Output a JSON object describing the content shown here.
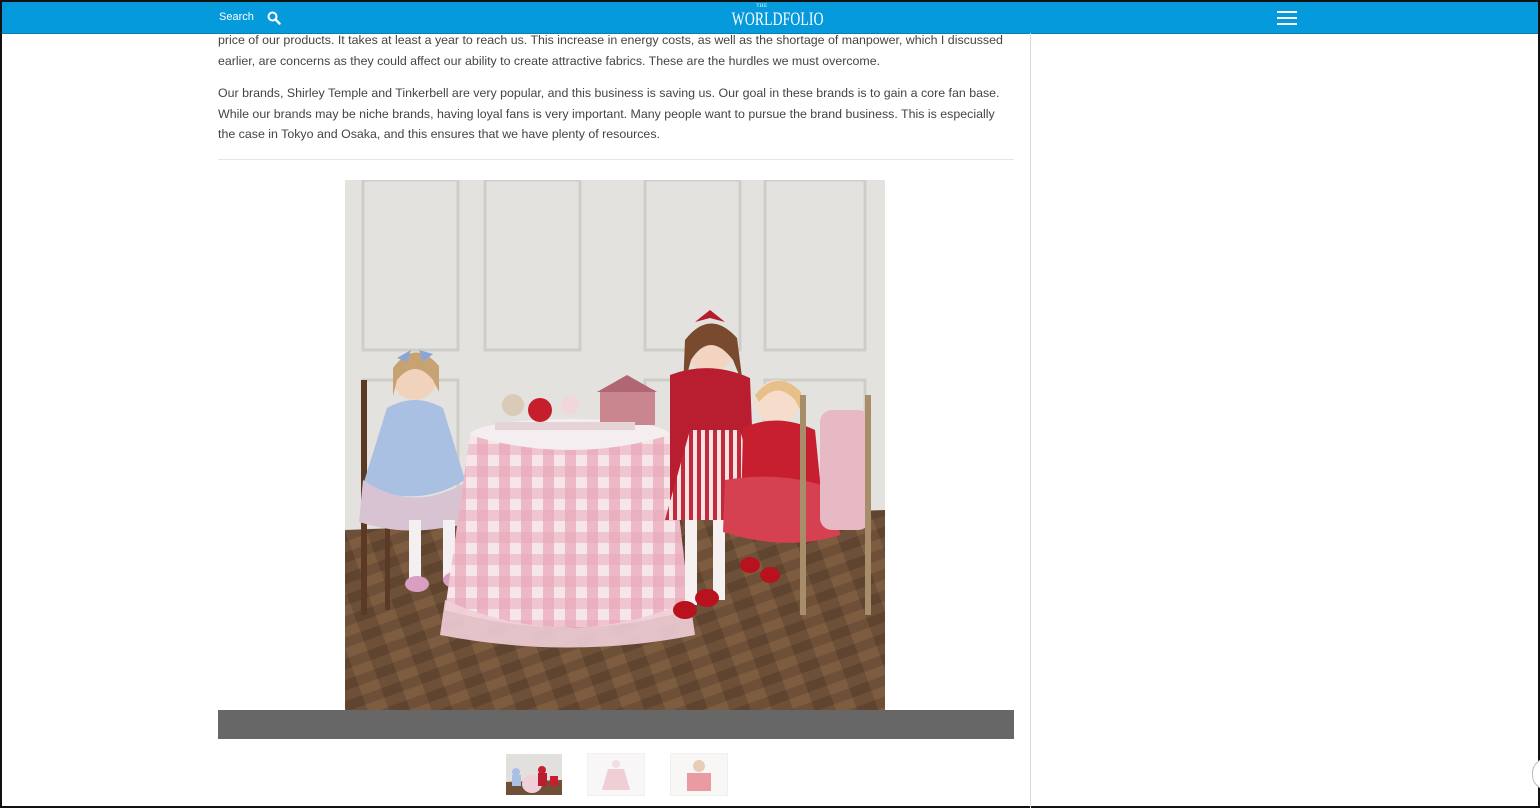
{
  "header": {
    "search_label": "Search",
    "logo_the": "THE",
    "logo_name": "WORLDFOLIO",
    "bar_color": "#049adb",
    "icons": [
      "search-icon",
      "menu-icon"
    ]
  },
  "article": {
    "paragraph_1": "price of our products. It takes at least a year to reach us. This increase in energy costs, as well as the shortage of manpower, which I discussed earlier, are concerns as they could affect our ability to create attractive fabrics. These are the hurdles we must overcome.",
    "paragraph_2": "Our brands, Shirley Temple and Tinkerbell are very popular, and this business is saving us. Our goal in these brands is to gain a core fan base. While our brands may be niche brands, having loyal fans is very important. Many people want to pursue the brand business. This is especially the case in Tokyo and Osaka, and this ensures that we have plenty of resources."
  },
  "gallery": {
    "caption": "",
    "caption_bar_color": "#676767",
    "thumbnail_count": 3,
    "active_thumbnail": 1
  }
}
